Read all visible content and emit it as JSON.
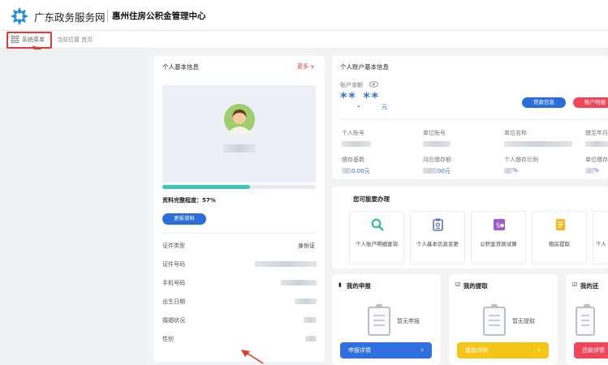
{
  "header": {
    "brand": "广东政务服务网",
    "center": "惠州住房公积金管理中心"
  },
  "crumb": {
    "menu": "系统菜单",
    "location": "当前位置",
    "home": "首页"
  },
  "basic": {
    "title": "个人基本信息",
    "more": "更多",
    "completeness_label": "资料完整程度：",
    "completeness_value": "57%",
    "completeness": 0.57,
    "update_btn": "更新资料",
    "fields": [
      {
        "label": "证件类型",
        "value": "身份证"
      },
      {
        "label": "证件号码",
        "value": ""
      },
      {
        "label": "手机号码",
        "value": ""
      },
      {
        "label": "出生日期",
        "value": ""
      },
      {
        "label": "婚姻状况",
        "value": ""
      },
      {
        "label": "性别",
        "value": ""
      }
    ]
  },
  "account": {
    "title": "个人账户基本信息",
    "balance_label": "账户余额",
    "balance_mask": "** **",
    "balance_dot": ".",
    "unit": "元",
    "loan_btn": "贷款信息",
    "detail_btn": "账户明细",
    "r1": {
      "a": "个人账号",
      "b": "单位账号",
      "c": "单位名称",
      "d": "缴至年月"
    },
    "r2": {
      "a": "缴存基数",
      "b": "月应缴存额",
      "c": "个人缴存比例",
      "d": "单位缴存"
    },
    "v2": {
      "a": "0.00元",
      "b": "00元",
      "c": "%",
      "d": "%"
    },
    "accent": "#2b6ddb",
    "red": "#f0465a"
  },
  "services": {
    "title": "您可能要办理",
    "items": [
      "个人账户明细查询",
      "个人基本信息变更",
      "公积金贷款试算",
      "租房提取",
      "个人"
    ]
  },
  "boxes": [
    {
      "title": "我的申报",
      "empty": "暂无申报",
      "btn": "申报详情",
      "color": "#2f6fe0"
    },
    {
      "title": "我的提取",
      "empty": "暂无提取",
      "btn": "提取详情",
      "color": "#f5c518"
    },
    {
      "title": "我的还",
      "btn": "还款详情",
      "color": "#f0465a"
    }
  ]
}
